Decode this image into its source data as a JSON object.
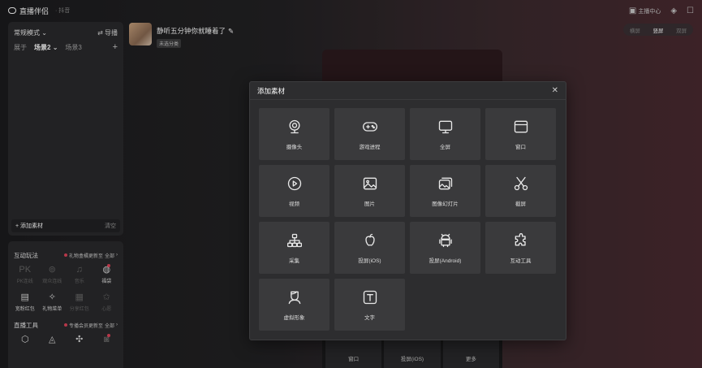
{
  "app": {
    "name": "直播伴侣",
    "platform": "· 抖音"
  },
  "topbar": {
    "host_center": "主播中心"
  },
  "left_panel": {
    "mode_label": "常规模式",
    "guide_label": "导播",
    "scenes": [
      "展于",
      "场景2",
      "场景3"
    ],
    "add_material": "添加素材",
    "clear": "清空"
  },
  "interactive": {
    "title": "互动玩法",
    "note": "礼物盒橘更新至",
    "all": "全部",
    "tools": [
      {
        "label": "PK连线",
        "icon": "pk-icon",
        "dim": true
      },
      {
        "label": "观众连线",
        "icon": "link-icon",
        "dim": true
      },
      {
        "label": "音乐",
        "icon": "music-icon",
        "dim": true
      },
      {
        "label": "福袋",
        "icon": "lucky-bag-icon",
        "dim": false,
        "dot": true
      },
      {
        "label": "宽粉红包",
        "icon": "red-packet-icon",
        "dim": false
      },
      {
        "label": "礼物菜单",
        "icon": "gift-menu-icon",
        "dim": false
      },
      {
        "label": "分享红包",
        "icon": "share-packet-icon",
        "dim": true
      },
      {
        "label": "心愿",
        "icon": "wish-icon",
        "dim": true
      }
    ]
  },
  "live_tools": {
    "title": "直播工具",
    "note": "专播会员更新至",
    "all": "全部"
  },
  "stream": {
    "title": "静听五分钟你就睡着了",
    "tag": "未选分类"
  },
  "orientation": {
    "options": [
      "横屏",
      "竖屏",
      "双屏"
    ],
    "selected": 1
  },
  "bottom_bar": [
    "窗口",
    "投屏(iOS)",
    "更多"
  ],
  "modal": {
    "title": "添加素材",
    "items": [
      {
        "label": "摄像头",
        "icon": "camera-icon"
      },
      {
        "label": "游戏进程",
        "icon": "gamepad-icon"
      },
      {
        "label": "全屏",
        "icon": "monitor-icon"
      },
      {
        "label": "窗口",
        "icon": "window-icon"
      },
      {
        "label": "视频",
        "icon": "video-play-icon"
      },
      {
        "label": "图片",
        "icon": "image-icon"
      },
      {
        "label": "图像幻灯片",
        "icon": "slideshow-icon"
      },
      {
        "label": "截屏",
        "icon": "scissors-icon"
      },
      {
        "label": "采集",
        "icon": "capture-tree-icon"
      },
      {
        "label": "投屏(iOS)",
        "icon": "apple-icon"
      },
      {
        "label": "投屏(Android)",
        "icon": "android-icon"
      },
      {
        "label": "互动工具",
        "icon": "puzzle-icon"
      },
      {
        "label": "虚拟形象",
        "icon": "avatar-icon"
      },
      {
        "label": "文字",
        "icon": "text-icon"
      }
    ]
  }
}
